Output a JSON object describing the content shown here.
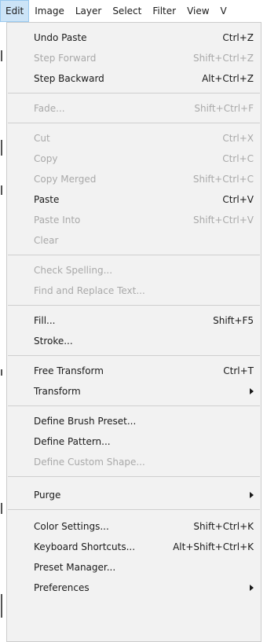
{
  "menubar": {
    "items": [
      {
        "label": "Edit",
        "active": true
      },
      {
        "label": "Image"
      },
      {
        "label": "Layer"
      },
      {
        "label": "Select"
      },
      {
        "label": "Filter"
      },
      {
        "label": "View"
      },
      {
        "label": "V"
      }
    ]
  },
  "edit_menu": {
    "undo_paste": {
      "label": "Undo Paste",
      "shortcut": "Ctrl+Z",
      "enabled": true
    },
    "step_forward": {
      "label": "Step Forward",
      "shortcut": "Shift+Ctrl+Z",
      "enabled": false
    },
    "step_backward": {
      "label": "Step Backward",
      "shortcut": "Alt+Ctrl+Z",
      "enabled": true
    },
    "fade": {
      "label": "Fade...",
      "shortcut": "Shift+Ctrl+F",
      "enabled": false
    },
    "cut": {
      "label": "Cut",
      "shortcut": "Ctrl+X",
      "enabled": false
    },
    "copy": {
      "label": "Copy",
      "shortcut": "Ctrl+C",
      "enabled": false
    },
    "copy_merged": {
      "label": "Copy Merged",
      "shortcut": "Shift+Ctrl+C",
      "enabled": false
    },
    "paste": {
      "label": "Paste",
      "shortcut": "Ctrl+V",
      "enabled": true
    },
    "paste_into": {
      "label": "Paste Into",
      "shortcut": "Shift+Ctrl+V",
      "enabled": false
    },
    "clear": {
      "label": "Clear",
      "enabled": false
    },
    "check_spelling": {
      "label": "Check Spelling...",
      "enabled": false
    },
    "find_replace": {
      "label": "Find and Replace Text...",
      "enabled": false
    },
    "fill": {
      "label": "Fill...",
      "shortcut": "Shift+F5",
      "enabled": true
    },
    "stroke": {
      "label": "Stroke...",
      "enabled": true
    },
    "free_transform": {
      "label": "Free Transform",
      "shortcut": "Ctrl+T",
      "enabled": true
    },
    "transform": {
      "label": "Transform",
      "enabled": true,
      "submenu": true
    },
    "define_brush": {
      "label": "Define Brush Preset...",
      "enabled": true
    },
    "define_pattern": {
      "label": "Define Pattern...",
      "enabled": true
    },
    "define_custom_shape": {
      "label": "Define Custom Shape...",
      "enabled": false
    },
    "purge": {
      "label": "Purge",
      "enabled": true,
      "submenu": true
    },
    "color_settings": {
      "label": "Color Settings...",
      "shortcut": "Shift+Ctrl+K",
      "enabled": true
    },
    "keyboard_shortcuts": {
      "label": "Keyboard Shortcuts...",
      "shortcut": "Alt+Shift+Ctrl+K",
      "enabled": true
    },
    "preset_manager": {
      "label": "Preset Manager...",
      "enabled": true
    },
    "preferences": {
      "label": "Preferences",
      "enabled": true,
      "submenu": true
    }
  },
  "colors": {
    "menu_background": "#f2f2f2",
    "active_menubar_highlight": "#cce4f7",
    "disabled_text": "#a9a9a9",
    "enabled_text": "#1a1a1a"
  }
}
